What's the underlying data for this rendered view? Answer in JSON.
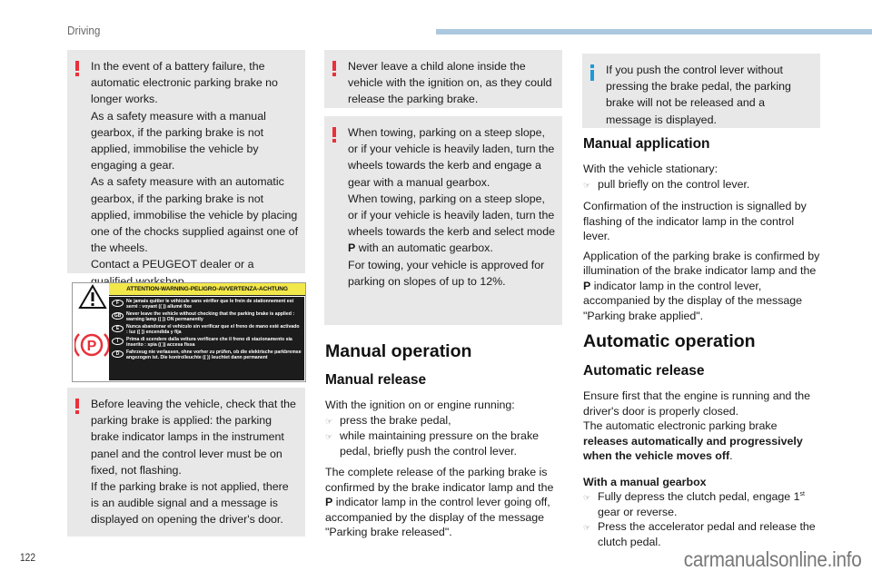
{
  "header": {
    "section": "Driving",
    "bar_color": "#abc8df"
  },
  "colors": {
    "warning": "#e8313a",
    "info": "#1f9ad6",
    "box_bg": "#e8e8e8"
  },
  "column1": {
    "box1": {
      "icon": "warning-exclamation-icon",
      "lines": [
        "In the event of a battery failure, the automatic electronic parking brake no longer works.",
        "As a safety measure with a manual gearbox, if the parking brake is not applied, immobilise the vehicle by engaging a gear.",
        "As a safety measure with an automatic gearbox, if the parking brake is not applied, immobilise the vehicle by placing one of the chocks supplied against one of the wheels.",
        "Contact a PEUGEOT dealer or a qualified workshop."
      ]
    },
    "label": {
      "heading": "ATTENTION-WARNING-PELIGRO-AVVERTENZA-ACHTUNG",
      "symbol": "P",
      "rows": [
        {
          "code": "F",
          "text": "Ne jamais quitter le véhicule sans vérifier que le frein de stationnement est serré : voyant (( )) allumé fixe"
        },
        {
          "code": "GB",
          "text": "Never leave the vehicle without checking that the parking brake is applied : warning lamp (( )) ON permanently"
        },
        {
          "code": "E",
          "text": "Nunca abandonar el vehículo sin verificar que el freno de mano esté activado : luz (( )) encendida y fija"
        },
        {
          "code": "I",
          "text": "Prima di scendere dalla vettura verificare che il freno di stazionamento sia inserito : spia (( )) accesa fissa"
        },
        {
          "code": "D",
          "text": "Fahrzeug nie verlassen, ohne vorher zu prüfen, ob die elektrische parkbremse angezogen ist. Die kontrolleuchte (( )) leuchtet dann permanent"
        }
      ]
    },
    "box2": {
      "icon": "warning-exclamation-icon",
      "lines": [
        "Before leaving the vehicle, check that the parking brake is applied: the parking brake indicator lamps in the instrument panel and the control lever must be on fixed, not flashing.",
        "If the parking brake is not applied, there is an audible signal and a message is displayed on opening the driver's door."
      ]
    }
  },
  "column2": {
    "box1": {
      "icon": "warning-exclamation-icon",
      "text": "Never leave a child alone inside the vehicle with the ignition on, as they could release the parking brake."
    },
    "box2": {
      "icon": "warning-exclamation-icon",
      "line1": "When towing, parking on a steep slope, or if your vehicle is heavily laden, turn the wheels towards the kerb and engage a gear with a manual gearbox.",
      "line2_pre": "When towing, parking on a steep slope, or if your vehicle is heavily laden, turn the wheels towards the kerb and select mode ",
      "line2_bold": "P",
      "line2_post": " with an automatic gearbox.",
      "line3": "For towing, your vehicle is approved for parking on slopes of up to 12%."
    },
    "h2": "Manual operation",
    "h3": "Manual release",
    "intro": "With the ignition on or engine running:",
    "bullets": [
      "press the brake pedal,",
      "while maintaining pressure on the brake pedal, briefly push the control lever."
    ],
    "para_pre": "The complete release of the parking brake is confirmed by the brake indicator lamp and the ",
    "para_bold": "P",
    "para_post": " indicator lamp in the control lever going off, accompanied by the display of the message \"Parking brake released\"."
  },
  "column3": {
    "info_box": {
      "icon": "info-icon",
      "text": "If you push the control lever without pressing the brake pedal, the parking brake will not be released and a message is displayed."
    },
    "h3_application": "Manual application",
    "intro": "With the vehicle stationary:",
    "bullet": "pull briefly on the control lever.",
    "para1": "Confirmation of the instruction is signalled by flashing of the indicator lamp in the control lever.",
    "para2_pre": "Application of the parking brake is confirmed by illumination of the brake indicator lamp and the ",
    "para2_bold": "P",
    "para2_post": " indicator lamp in the control lever, accompanied by the display of the message \"Parking brake applied\".",
    "h2": "Automatic operation",
    "h3_release": "Automatic release",
    "para3a": "Ensure first that the engine is running and the driver's door is properly closed.",
    "para3b": "The automatic electronic parking brake ",
    "para3_bold": "releases automatically and progressively when the vehicle moves off",
    "para3_end": ".",
    "gearbox_heading": "With a manual gearbox",
    "gearbox_bullet1_pre": "Fully depress the clutch pedal, engage 1",
    "gearbox_bullet1_sup": "st",
    "gearbox_bullet1_post": " gear or reverse.",
    "gearbox_bullet2": "Press the accelerator pedal and release the clutch pedal."
  },
  "footer": {
    "page_number": "122",
    "watermark": "carmanualsonline.info"
  }
}
